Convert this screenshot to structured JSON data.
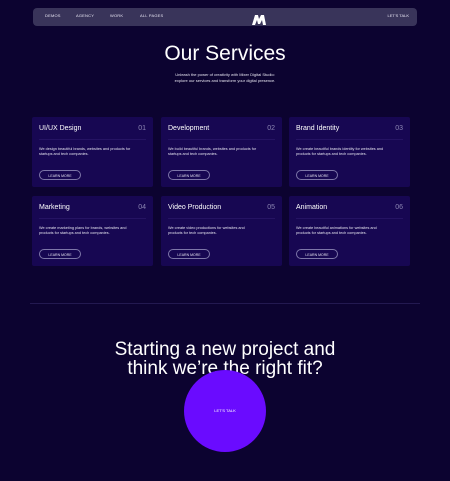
{
  "nav": {
    "links": [
      "DEMOS",
      "AGENCY",
      "WORK",
      "ALL PAGES"
    ],
    "logo_icon": "m-logo-icon",
    "cta": "LET'S TALK"
  },
  "hero": {
    "title": "Our Services",
    "subtitle_line1": "Unleash the power of creativity with Mixer Digital Studio:",
    "subtitle_line2": "explore our services and transform your digital presence."
  },
  "services": [
    {
      "title": "UI/UX Design",
      "num": "01",
      "desc": "We design beautiful brands, websites and products for startups and tech companies.",
      "button": "LEARN MORE"
    },
    {
      "title": "Development",
      "num": "02",
      "desc": "We build beautiful brands, websites and products for startups and tech companies.",
      "button": "LEARN MORE"
    },
    {
      "title": "Brand Identity",
      "num": "03",
      "desc": "We create beautiful brands identity for websites and products for startups and tech companies.",
      "button": "LEARN MORE"
    },
    {
      "title": "Marketing",
      "num": "04",
      "desc": "We create marketing plans for brands, websites and products for startups and tech companies.",
      "button": "LEARN MORE"
    },
    {
      "title": "Video Production",
      "num": "05",
      "desc": "We create video productions for websites and products for tech companies.",
      "button": "LEARN MORE"
    },
    {
      "title": "Animation",
      "num": "06",
      "desc": "We create beautiful animations for websites and products for startups and tech companies.",
      "button": "LEARN MORE"
    }
  ],
  "cta_section": {
    "line1": "Starting a new project and",
    "line2": "think we’re the right fit?",
    "button": "LET'S TALK"
  },
  "colors": {
    "background": "#0c0330",
    "card": "#170752",
    "accent": "#6a0bff",
    "nav": "#39345a"
  }
}
